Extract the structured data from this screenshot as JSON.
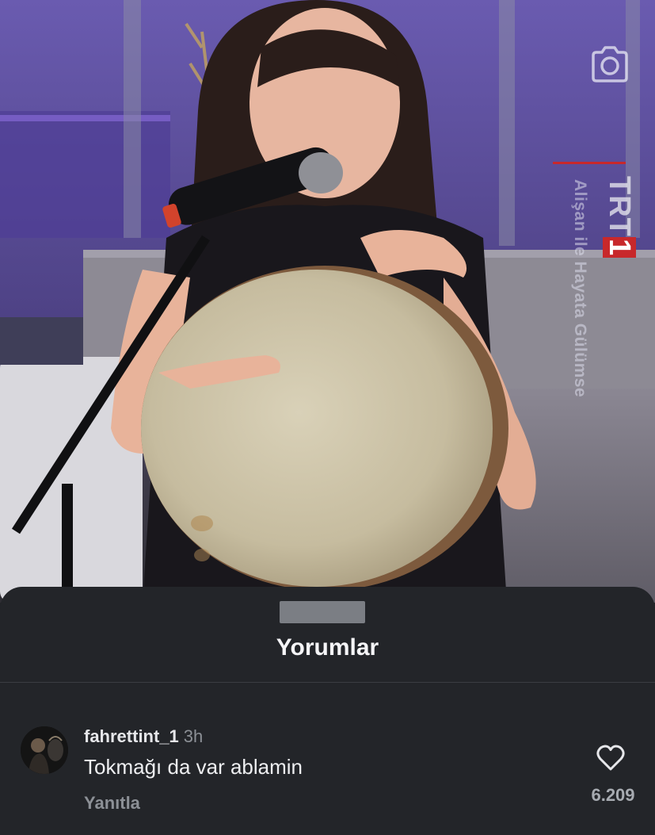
{
  "video": {
    "channel_logo_text": "TRT",
    "channel_logo_number": "1",
    "show_title": "Alişan ile Hayata Gülümse",
    "camera_icon": "camera-icon"
  },
  "comments_sheet": {
    "title": "Yorumlar",
    "comments": [
      {
        "username": "fahrettint_1",
        "time": "3h",
        "text": "Tokmağı da var ablamin",
        "reply_label": "Yanıtla",
        "like_icon": "heart-outline-icon",
        "like_count": "6.209"
      }
    ]
  },
  "colors": {
    "sheet_background": "#232529",
    "primary_text": "#f5f5f7",
    "secondary_text": "#8c9096",
    "accent_red": "#c8282b"
  }
}
